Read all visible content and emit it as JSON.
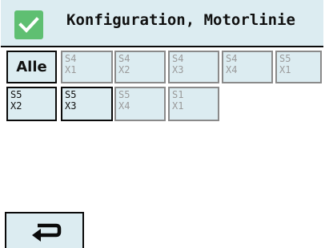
{
  "header": {
    "title": "Konfiguration, Motorlinie",
    "check_icon": "checkmark-icon",
    "check_color": "#5fbf72"
  },
  "tiles": [
    {
      "label": "Alle",
      "enabled": true
    },
    {
      "line1": "S4",
      "line2": "X1",
      "enabled": false
    },
    {
      "line1": "S4",
      "line2": "X2",
      "enabled": false
    },
    {
      "line1": "S4",
      "line2": "X3",
      "enabled": false
    },
    {
      "line1": "S4",
      "line2": "X4",
      "enabled": false
    },
    {
      "line1": "S5",
      "line2": "X1",
      "enabled": false
    },
    {
      "line1": "S5",
      "line2": "X2",
      "enabled": true
    },
    {
      "line1": "S5",
      "line2": "X3",
      "enabled": true
    },
    {
      "line1": "S5",
      "line2": "X4",
      "enabled": false
    },
    {
      "line1": "S1",
      "line2": "X1",
      "enabled": false
    }
  ],
  "footer": {
    "back_icon": "return-arrow-icon"
  },
  "colors": {
    "panel_background": "#dcecf1",
    "disabled_text": "#9a9a9a"
  }
}
